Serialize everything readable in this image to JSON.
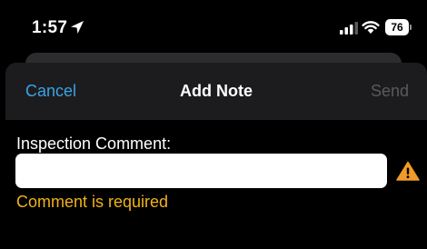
{
  "status_bar": {
    "time": "1:57",
    "battery_level": "76",
    "icons": [
      "location-arrow-icon",
      "signal-bars-icon",
      "wifi-icon",
      "battery-icon"
    ]
  },
  "nav": {
    "cancel_label": "Cancel",
    "title": "Add Note",
    "send_label": "Send"
  },
  "form": {
    "comment_label": "Inspection Comment:",
    "comment_value": "",
    "comment_placeholder": "",
    "error_message": "Comment is required",
    "warning_icon": "warning-triangle-icon"
  },
  "colors": {
    "accent": "#3aa3e6",
    "error": "#f0b21c",
    "warning": "#f09a2a",
    "disabled": "#5a5a5e",
    "nav_background": "#1c1c1e"
  }
}
